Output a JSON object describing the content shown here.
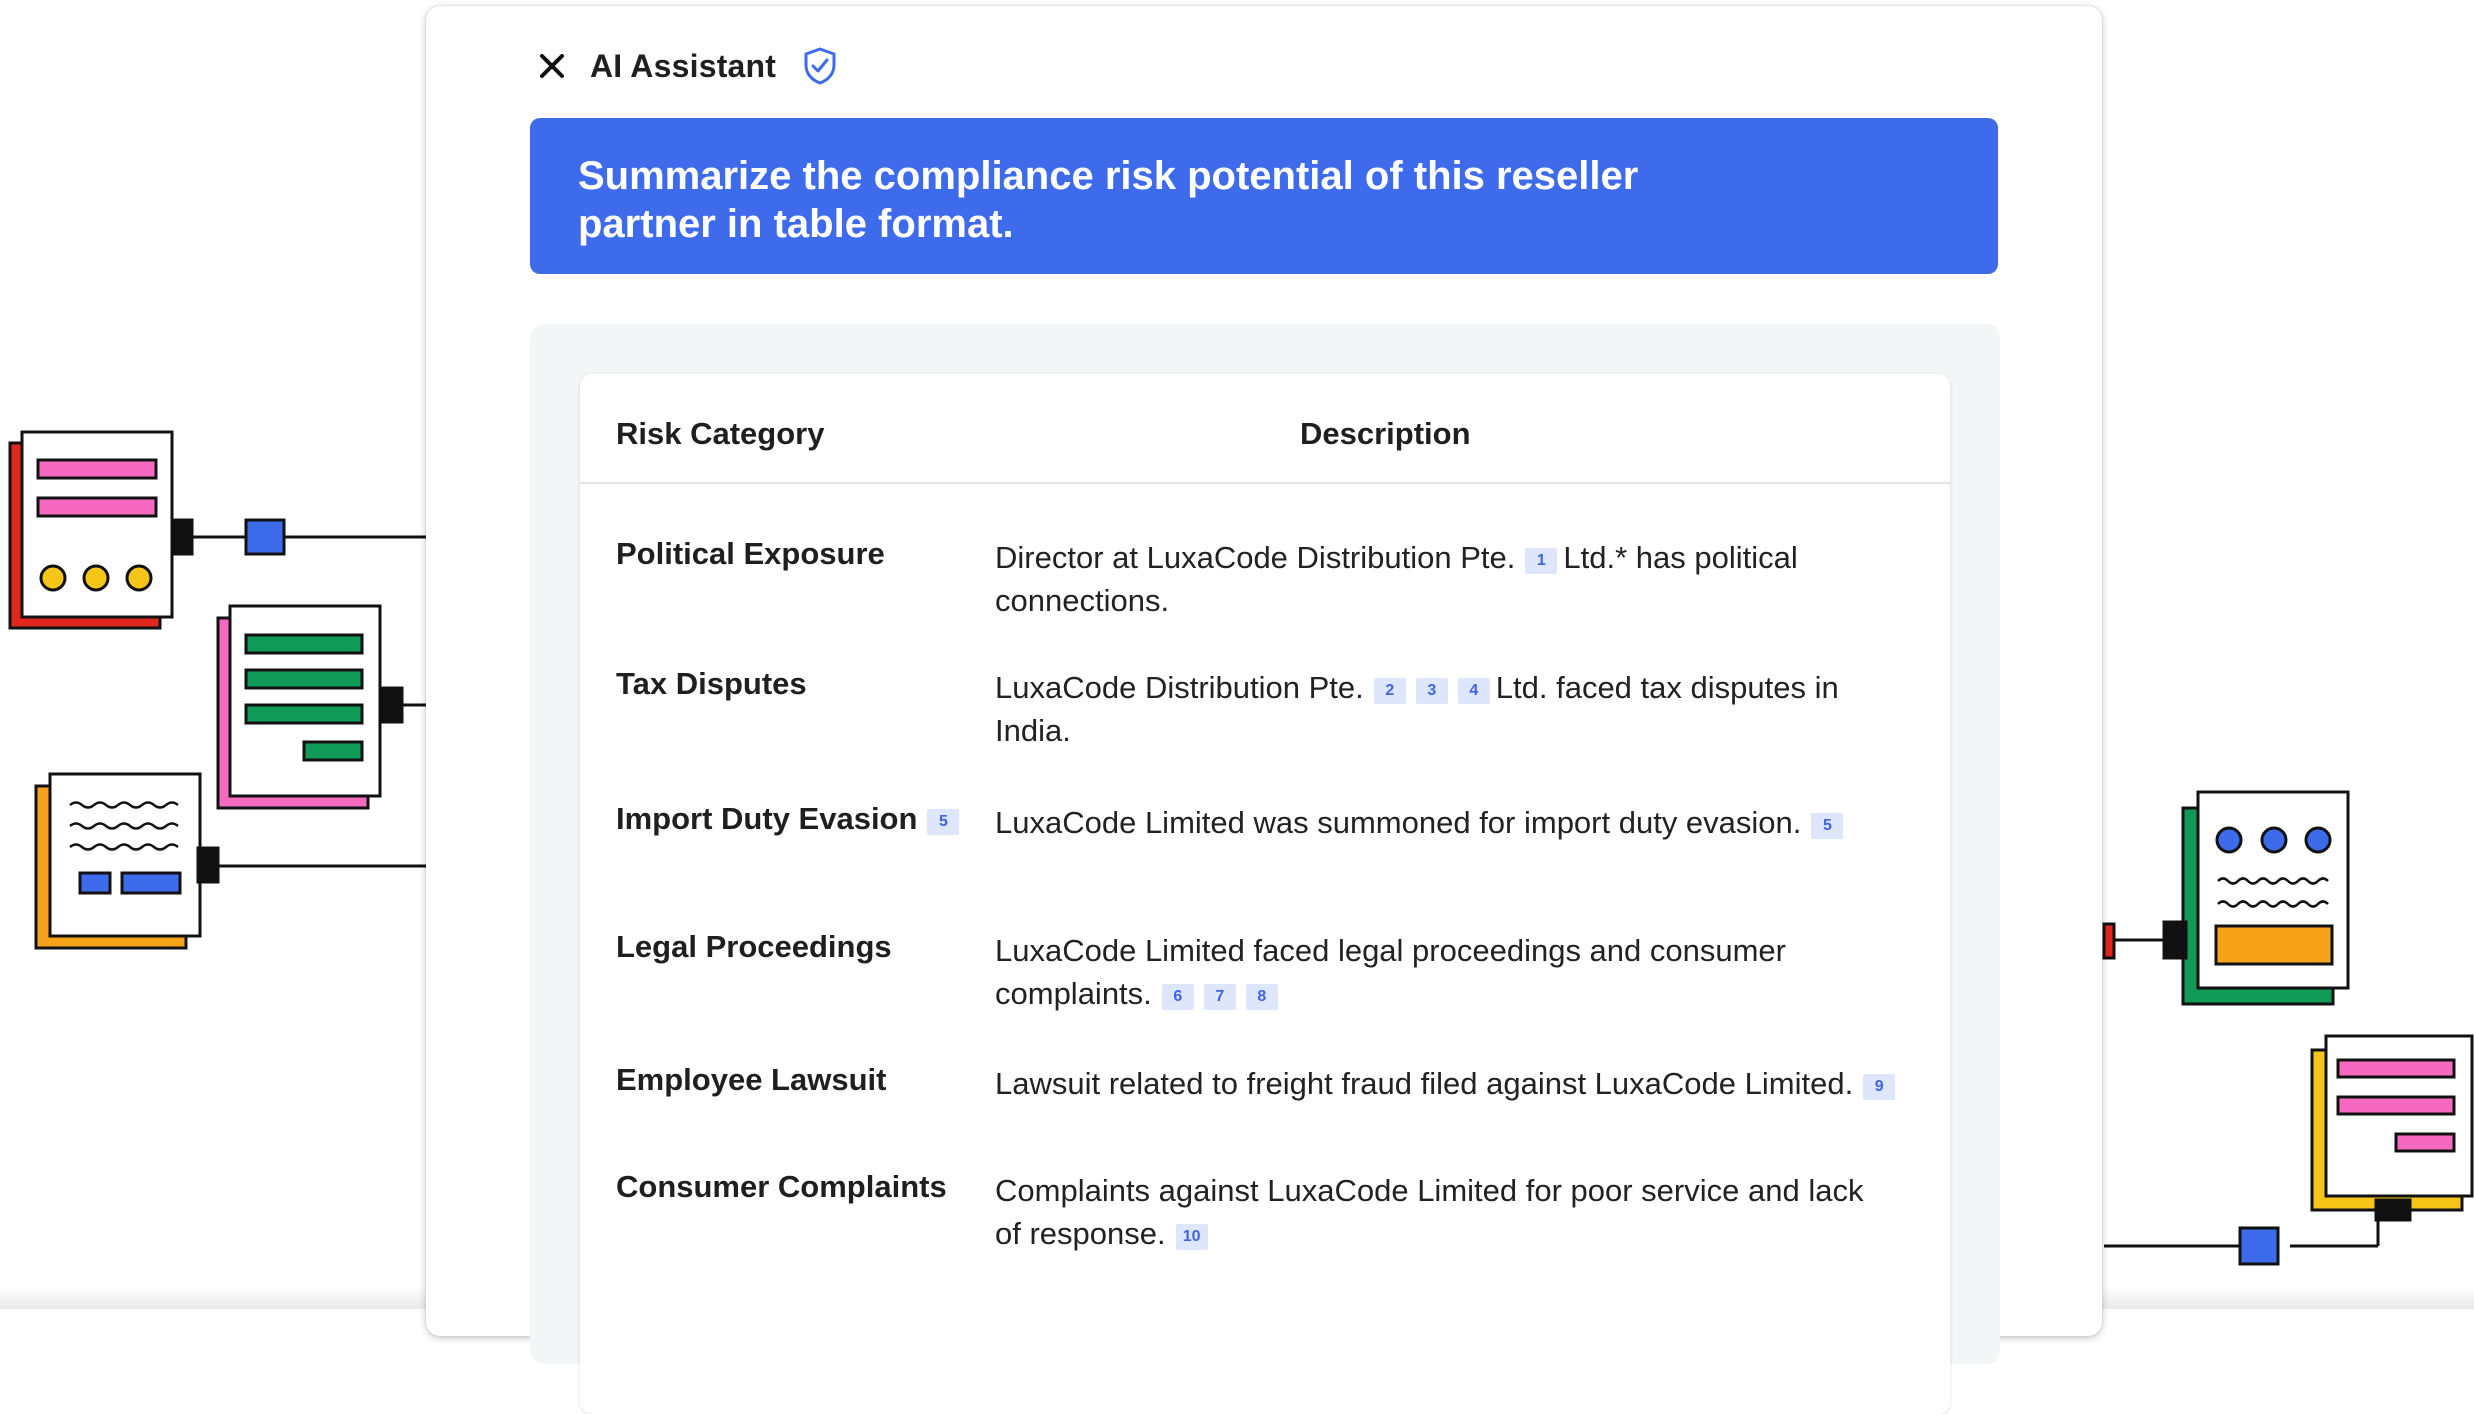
{
  "assistant": {
    "title": "AI Assistant",
    "icons": {
      "close": "close-icon",
      "shield": "shield-check-icon"
    }
  },
  "prompt": {
    "text": "Summarize the compliance risk potential of this reseller partner in table format."
  },
  "table": {
    "headers": {
      "category": "Risk Category",
      "description": "Description"
    },
    "rows": [
      {
        "category": "Political Exposure",
        "desc_a": "Director at LuxaCode Distribution Pte.",
        "cites_a": [
          "1"
        ],
        "desc_b": "Ltd.* has political connections.",
        "cites_b": []
      },
      {
        "category": "Tax Disputes",
        "desc_a": "LuxaCode Distribution Pte.",
        "cites_a": [
          "2",
          "3",
          "4"
        ],
        "desc_b": "Ltd. faced tax disputes in India.",
        "cites_b": []
      },
      {
        "category": "Import Duty Evasion",
        "category_cite": "5",
        "desc_a": "LuxaCode Limited was summoned for import duty evasion.",
        "cites_a": [
          "5"
        ]
      },
      {
        "category": "Legal Proceedings",
        "desc_a": "LuxaCode Limited faced legal proceedings and consumer complaints.",
        "cites_a": [
          "6",
          "7",
          "8"
        ]
      },
      {
        "category": "Employee Lawsuit",
        "desc_a": "Lawsuit related to freight fraud filed against LuxaCode Limited.",
        "cites_a": [
          "9"
        ]
      },
      {
        "category": "Consumer Complaints",
        "desc_a": "Complaints against LuxaCode Limited for poor service and lack of response.",
        "cites_a": [
          "10"
        ]
      }
    ]
  },
  "colors": {
    "accent": "#3e6bec",
    "citation_bg": "#dde6fb",
    "citation_text": "#3e63e6",
    "doc_red": "#e0261d",
    "doc_pink": "#f56ac0",
    "doc_green": "#0f9b57",
    "doc_orange": "#f7a319",
    "doc_yellow": "#f5c518",
    "node_blue": "#3e6bec"
  }
}
